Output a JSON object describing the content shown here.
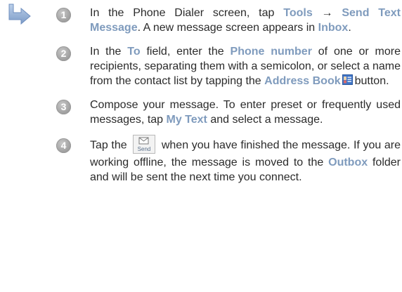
{
  "steps": [
    {
      "number": "1",
      "parts": [
        {
          "t": "In the Phone Dialer screen, tap "
        },
        {
          "t": "Tools",
          "kw": true
        },
        {
          "t": " → "
        },
        {
          "t": "Send Text Message",
          "kw": true
        },
        {
          "t": ". A new message screen appears in "
        },
        {
          "t": "Inbox",
          "kw": true
        },
        {
          "t": "."
        }
      ]
    },
    {
      "number": "2",
      "parts": [
        {
          "t": "In the "
        },
        {
          "t": "To",
          "kw": true
        },
        {
          "t": " field, enter the "
        },
        {
          "t": "Phone number",
          "kw": true
        },
        {
          "t": " of one or more recipients, separating them with a semicolon, or select a name from the contact list by tapping the "
        },
        {
          "t": "Address Book",
          "kw": true
        },
        {
          "icon": "address-book-icon"
        },
        {
          "t": "button."
        }
      ]
    },
    {
      "number": "3",
      "parts": [
        {
          "t": "Compose your message. To enter preset or frequently  used messages, tap "
        },
        {
          "t": "My Text",
          "kw": true
        },
        {
          "t": " and select a message."
        }
      ]
    },
    {
      "number": "4",
      "parts": [
        {
          "t": "Tap the "
        },
        {
          "icon": "send-icon",
          "label": "Send"
        },
        {
          "t": " when you have finished the message. If you are working offline, the message is moved to the "
        },
        {
          "t": "Outbox",
          "kw": true
        },
        {
          "t": " folder and will be sent the next time you connect."
        }
      ]
    }
  ],
  "colors": {
    "keyword": "#7f9bbd",
    "body_text": "#2b2b2b",
    "badge": "#a3a3a3"
  }
}
